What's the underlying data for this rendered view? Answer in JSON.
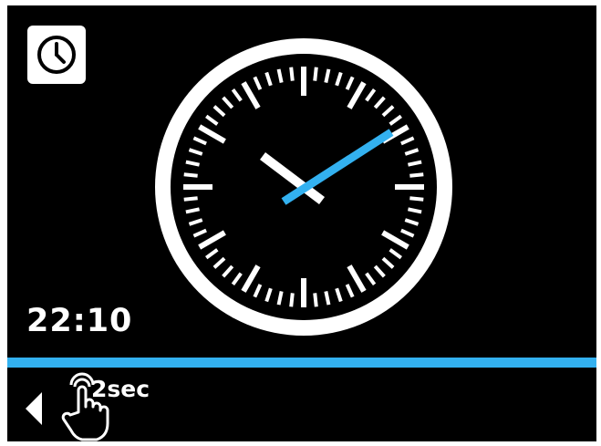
{
  "header": {
    "app_icon": "clock-icon"
  },
  "clock": {
    "hour_hand_color": "#ffffff",
    "minute_hand_color": "#33b1f0",
    "dial_color": "#ffffff",
    "face_color": "#000000"
  },
  "time_display": {
    "text": "22:10"
  },
  "divider": {
    "color": "#33b1f0"
  },
  "footer": {
    "back_icon": "triangle-left-icon",
    "press_icon": "hand-press-icon",
    "press_duration_label": "2sec"
  }
}
